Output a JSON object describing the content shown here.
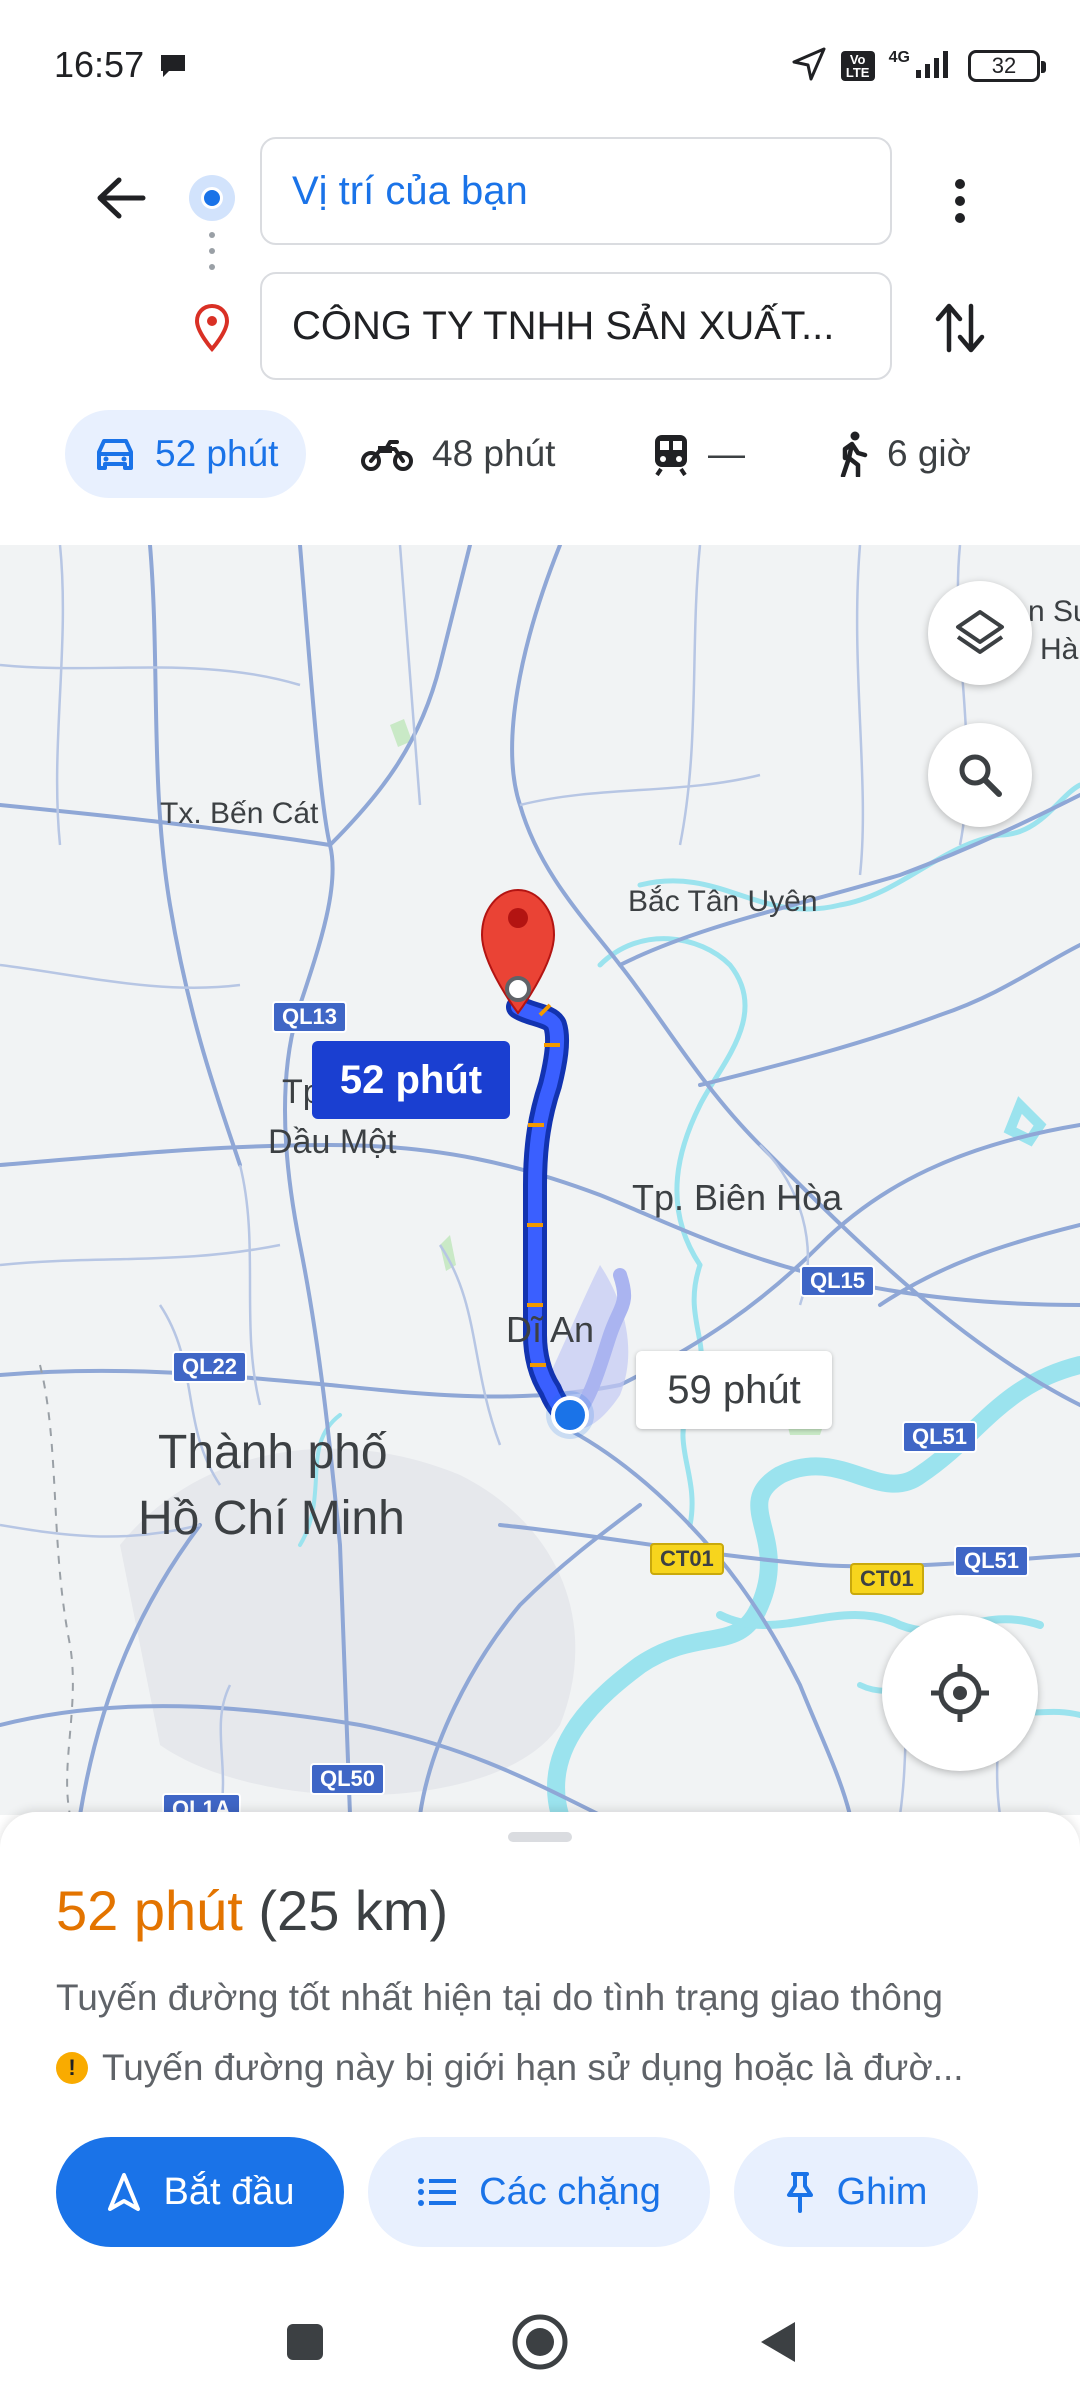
{
  "status_bar": {
    "time": "16:57",
    "network": "4G",
    "volte": "Vo LTE",
    "battery": "32"
  },
  "directions": {
    "origin_text": "Vị trí của bạn",
    "destination_text": "CÔNG TY TNHH SẢN XUẤT...",
    "modes": [
      {
        "name": "car",
        "label": "52 phút",
        "active": true
      },
      {
        "name": "motorbike",
        "label": "48 phút",
        "active": false
      },
      {
        "name": "transit",
        "label": "—",
        "active": false
      },
      {
        "name": "walk",
        "label": "6 giờ",
        "active": false
      }
    ]
  },
  "map": {
    "labels": {
      "ben_cat": "Tx. Bến Cát",
      "bac_tan_uyen": "Bắc Tân Uyên",
      "tp": "Tp",
      "dau_mot": "Dầu Một",
      "bien_hoa": "Tp. Biên Hòa",
      "di_an": "Dĩ An",
      "hcm_line1": "Thành phố",
      "hcm_line2": "Hồ Chí Minh",
      "edge_top1": "n Sư",
      "edge_top2": "Hà"
    },
    "roads": {
      "ql13": "QL13",
      "ql22": "QL22",
      "ql15": "QL15",
      "ql51_a": "QL51",
      "ql51_b": "QL51",
      "ct01_a": "CT01",
      "ct01_b": "CT01",
      "ql50": "QL50",
      "ql1a": "QL1A"
    },
    "route_primary_time": "52 phút",
    "route_alt_time": "59 phút",
    "colors": {
      "route": "#1a3fd1",
      "route_alt": "#aab4f0",
      "water": "#9be3ee",
      "road": "#8fa7d6",
      "pin": "#ea4335"
    }
  },
  "sheet": {
    "summary_time": "52 phút",
    "summary_distance": "(25 km)",
    "subtitle": "Tuyến đường tốt nhất hiện tại do tình trạng giao thông",
    "warning": "Tuyến đường này bị giới hạn sử dụng hoặc là đườ...",
    "buttons": {
      "start": "Bắt đầu",
      "steps": "Các chặng",
      "pin": "Ghim"
    }
  }
}
